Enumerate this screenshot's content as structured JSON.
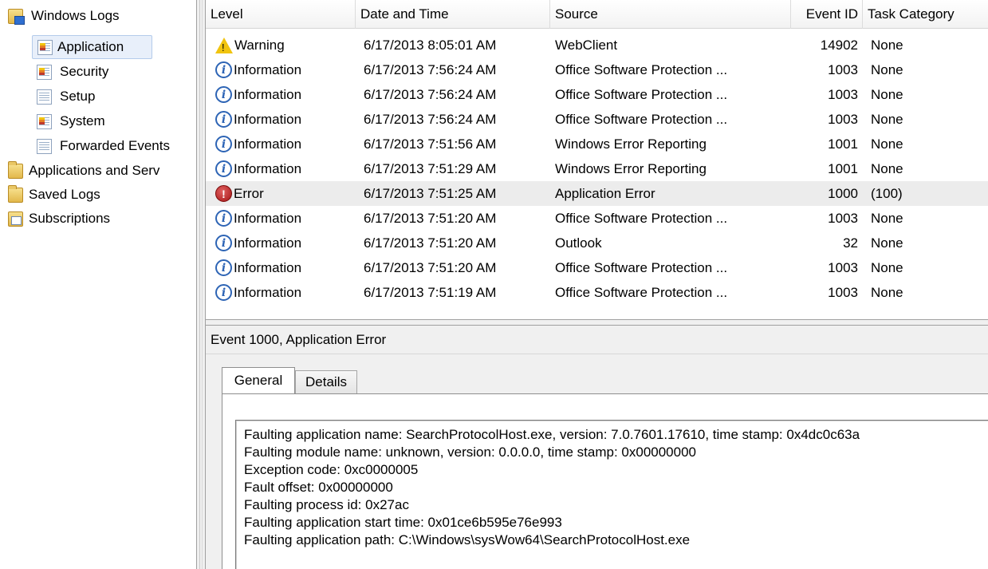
{
  "tree": {
    "items": [
      {
        "label": "Windows Logs",
        "icon": "windows-logs-folder-icon"
      },
      {
        "label": "Application",
        "icon": "application-log-icon"
      },
      {
        "label": "Security",
        "icon": "security-log-icon"
      },
      {
        "label": "Setup",
        "icon": "setup-log-icon"
      },
      {
        "label": "System",
        "icon": "system-log-icon"
      },
      {
        "label": "Forwarded Events",
        "icon": "forwarded-events-log-icon"
      },
      {
        "label": "Applications and Serv",
        "icon": "folder-icon"
      },
      {
        "label": "Saved Logs",
        "icon": "folder-icon"
      },
      {
        "label": "Subscriptions",
        "icon": "subscriptions-icon"
      }
    ]
  },
  "grid": {
    "columns": [
      "Level",
      "Date and Time",
      "Source",
      "Event ID",
      "Task Category"
    ],
    "rows": [
      {
        "level": "Warning",
        "date": "6/17/2013 8:05:01 AM",
        "source": "WebClient",
        "id": "14902",
        "category": "None"
      },
      {
        "level": "Information",
        "date": "6/17/2013 7:56:24 AM",
        "source": "Office Software Protection ...",
        "id": "1003",
        "category": "None"
      },
      {
        "level": "Information",
        "date": "6/17/2013 7:56:24 AM",
        "source": "Office Software Protection ...",
        "id": "1003",
        "category": "None"
      },
      {
        "level": "Information",
        "date": "6/17/2013 7:56:24 AM",
        "source": "Office Software Protection ...",
        "id": "1003",
        "category": "None"
      },
      {
        "level": "Information",
        "date": "6/17/2013 7:51:56 AM",
        "source": "Windows Error Reporting",
        "id": "1001",
        "category": "None"
      },
      {
        "level": "Information",
        "date": "6/17/2013 7:51:29 AM",
        "source": "Windows Error Reporting",
        "id": "1001",
        "category": "None"
      },
      {
        "level": "Error",
        "date": "6/17/2013 7:51:25 AM",
        "source": "Application Error",
        "id": "1000",
        "category": "(100)"
      },
      {
        "level": "Information",
        "date": "6/17/2013 7:51:20 AM",
        "source": "Office Software Protection ...",
        "id": "1003",
        "category": "None"
      },
      {
        "level": "Information",
        "date": "6/17/2013 7:51:20 AM",
        "source": "Outlook",
        "id": "32",
        "category": "None"
      },
      {
        "level": "Information",
        "date": "6/17/2013 7:51:20 AM",
        "source": "Office Software Protection ...",
        "id": "1003",
        "category": "None"
      },
      {
        "level": "Information",
        "date": "6/17/2013 7:51:19 AM",
        "source": "Office Software Protection ...",
        "id": "1003",
        "category": "None"
      }
    ]
  },
  "preview": {
    "title": "Event 1000, Application Error",
    "tabs": [
      "General",
      "Details"
    ],
    "lines": [
      "Faulting application name: SearchProtocolHost.exe, version: 7.0.7601.17610, time stamp: 0x4dc0c63a",
      "Faulting module name: unknown, version: 0.0.0.0, time stamp: 0x00000000",
      "Exception code: 0xc0000005",
      "Fault offset: 0x00000000",
      "Faulting process id: 0x27ac",
      "Faulting application start time: 0x01ce6b595e76e993",
      "Faulting application path: C:\\Windows\\sysWow64\\SearchProtocolHost.exe"
    ]
  },
  "colors": {
    "selection": "#e8effa",
    "selected_row": "#ececec",
    "info_icon": "#2d64b5",
    "error_icon": "#a51414",
    "warning_icon": "#f1c40f"
  }
}
